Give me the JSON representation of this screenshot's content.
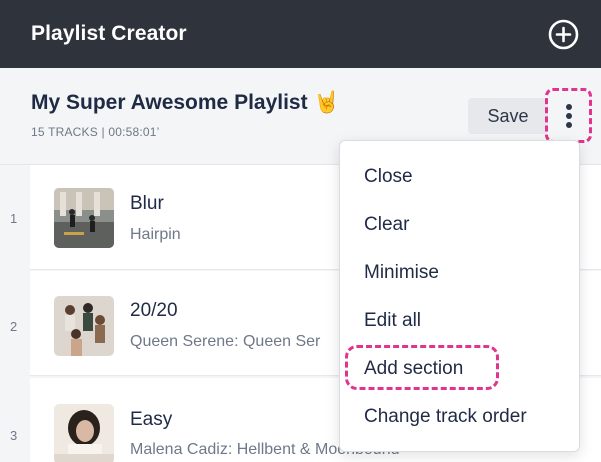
{
  "app": {
    "title": "Playlist Creator",
    "add_icon": "plus-circle-icon"
  },
  "playlist": {
    "title": "My Super Awesome Playlist 🤘",
    "meta": "15 TRACKS | 00:58:01’",
    "save_label": "Save",
    "more_icon": "vertical-dots-icon"
  },
  "tracks": [
    {
      "number": "1",
      "title": "Blur",
      "artist": "Hairpin"
    },
    {
      "number": "2",
      "title": "20/20",
      "artist": "Queen Serene: Queen Ser"
    },
    {
      "number": "3",
      "title": "Easy",
      "artist": "Malena Cadiz: Hellbent & Moonbound"
    }
  ],
  "menu": {
    "items": [
      "Close",
      "Clear",
      "Minimise",
      "Edit all",
      "Add section",
      "Change track order"
    ],
    "highlighted": "Add section"
  },
  "colors": {
    "titlebar_bg": "#2f343c",
    "highlight": "#e0348f",
    "text_primary": "#1f2a44",
    "text_secondary": "#6f7889"
  }
}
